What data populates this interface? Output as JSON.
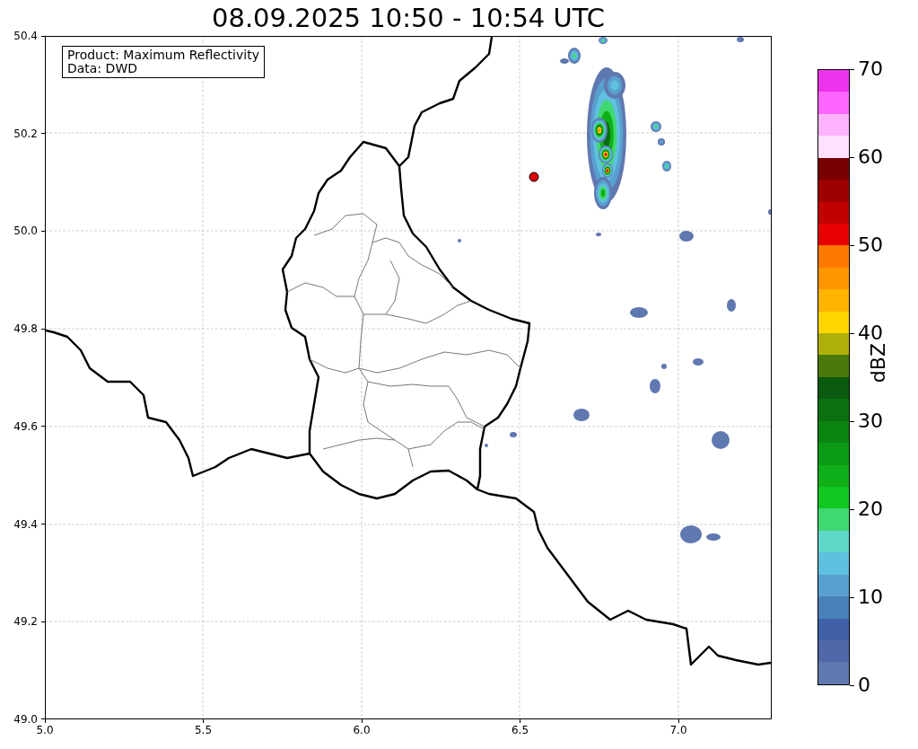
{
  "title": "08.09.2025 10:50 - 10:54 UTC",
  "map": {
    "legend": [
      "Product: Maximum Reflectivity",
      "Data: DWD"
    ],
    "y_ticks": [
      "50.4",
      "50.2",
      "50.0",
      "49.8",
      "49.6",
      "49.4",
      "49.2",
      "49.0"
    ],
    "x_ticks": [
      "5.0",
      "5.5",
      "6.0",
      "6.5",
      "7.0"
    ]
  },
  "colorbar": {
    "label": "dBZ",
    "ticks": [
      "70",
      "60",
      "50",
      "40",
      "30",
      "20",
      "10",
      "0"
    ],
    "segments": [
      {
        "color": "#ee33ee"
      },
      {
        "color": "#ff66ff"
      },
      {
        "color": "#ffb3ff"
      },
      {
        "color": "#ffe0ff"
      },
      {
        "color": "#780000"
      },
      {
        "color": "#9e0000"
      },
      {
        "color": "#c00000"
      },
      {
        "color": "#e60000"
      },
      {
        "color": "#ff7800"
      },
      {
        "color": "#ff9600"
      },
      {
        "color": "#ffb400"
      },
      {
        "color": "#ffd700"
      },
      {
        "color": "#b0b00a"
      },
      {
        "color": "#4a7a0a"
      },
      {
        "color": "#0a5a10"
      },
      {
        "color": "#0a7010"
      },
      {
        "color": "#0a8510"
      },
      {
        "color": "#0a9a15"
      },
      {
        "color": "#10b01a"
      },
      {
        "color": "#10c820"
      },
      {
        "color": "#40d870"
      },
      {
        "color": "#60d8c8"
      },
      {
        "color": "#60c0e0"
      },
      {
        "color": "#58a0d0"
      },
      {
        "color": "#4a80b8"
      },
      {
        "color": "#4060a8"
      },
      {
        "color": "#5068a8"
      },
      {
        "color": "#6078b0"
      }
    ]
  }
}
